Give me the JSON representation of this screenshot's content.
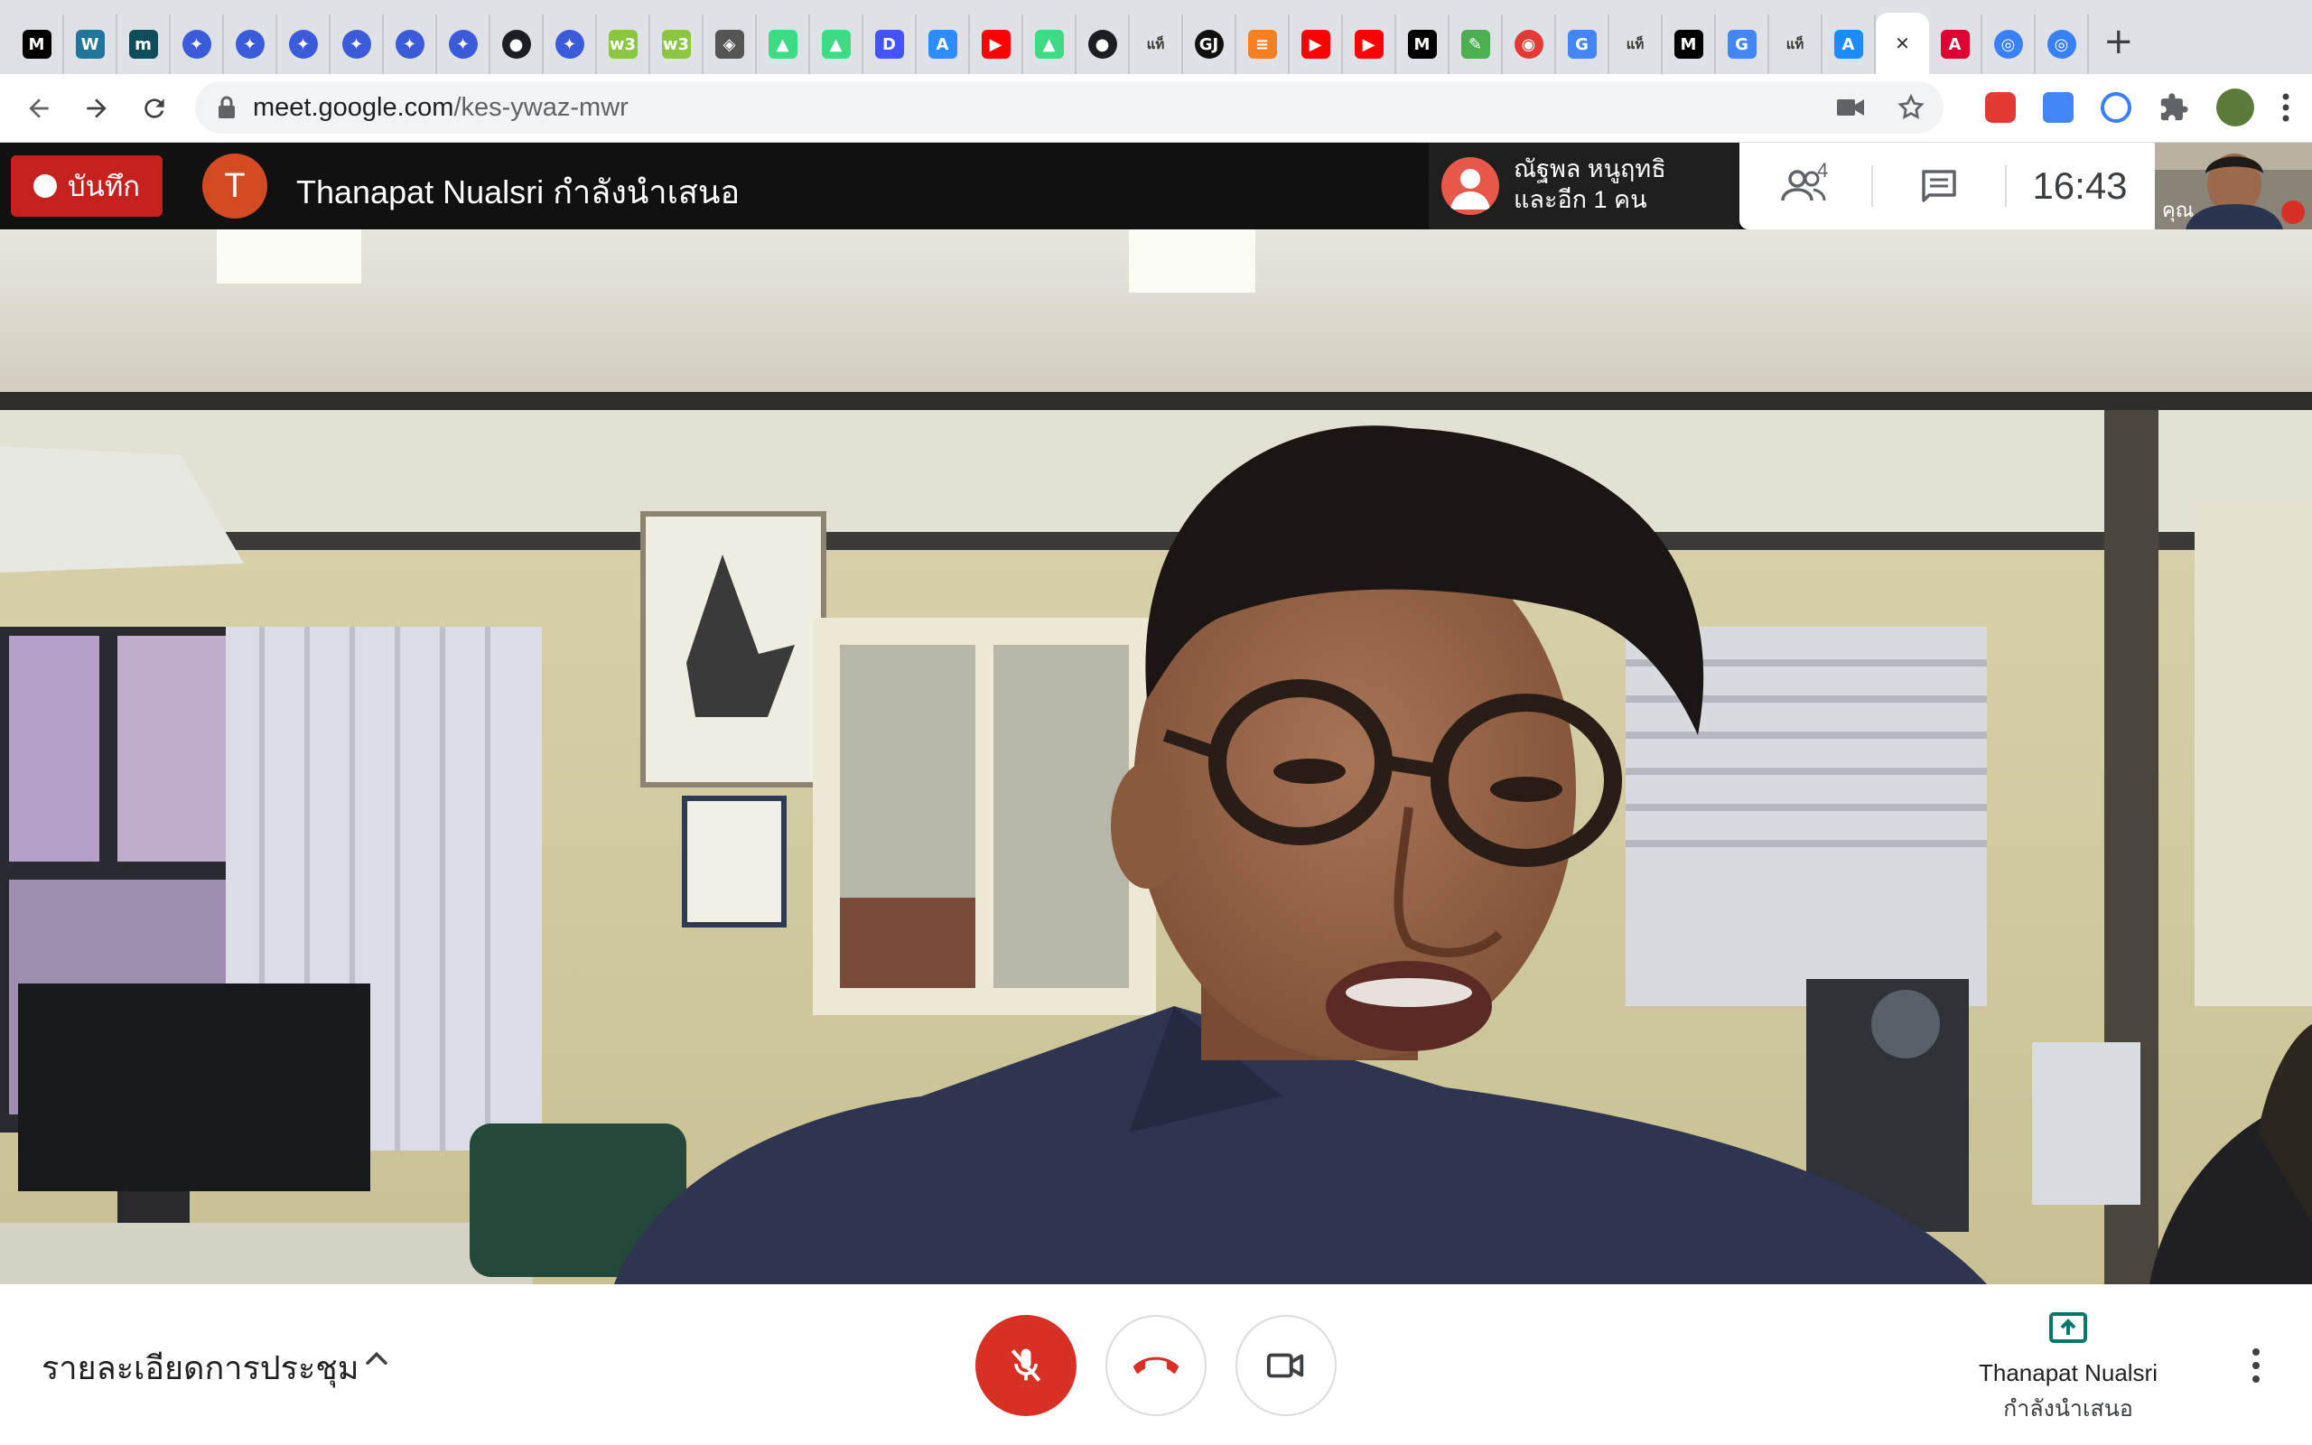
{
  "browser": {
    "tabs": [
      {
        "icon": "medium-icon",
        "glyph": "M",
        "color": "#000000"
      },
      {
        "icon": "wordpress-icon",
        "glyph": "W",
        "color": "#21759b"
      },
      {
        "icon": "m-brand-icon",
        "glyph": "m",
        "color": "#0f4c5c"
      },
      {
        "icon": "messenger-icon",
        "glyph": "✦",
        "color": "#3b5bdb"
      },
      {
        "icon": "messenger-icon",
        "glyph": "✦",
        "color": "#3b5bdb"
      },
      {
        "icon": "messenger-icon",
        "glyph": "✦",
        "color": "#3b5bdb"
      },
      {
        "icon": "messenger-icon",
        "glyph": "✦",
        "color": "#3b5bdb"
      },
      {
        "icon": "messenger-icon",
        "glyph": "✦",
        "color": "#3b5bdb"
      },
      {
        "icon": "messenger-icon",
        "glyph": "✦",
        "color": "#3b5bdb"
      },
      {
        "icon": "github-icon",
        "glyph": "●",
        "color": "#1b1f23"
      },
      {
        "icon": "messenger-icon",
        "glyph": "✦",
        "color": "#3b5bdb"
      },
      {
        "icon": "w3-icon",
        "glyph": "w3",
        "color": "#8ac640"
      },
      {
        "icon": "w3-icon",
        "glyph": "w3",
        "color": "#8ac640"
      },
      {
        "icon": "diamond-icon",
        "glyph": "◈",
        "color": "#555555"
      },
      {
        "icon": "android-icon",
        "glyph": "▲",
        "color": "#3ddc84"
      },
      {
        "icon": "android-icon",
        "glyph": "▲",
        "color": "#3ddc84"
      },
      {
        "icon": "dart-icon",
        "glyph": "D",
        "color": "#4353ff"
      },
      {
        "icon": "app-store-icon",
        "glyph": "A",
        "color": "#2d8cff"
      },
      {
        "icon": "youtube-icon",
        "glyph": "▶",
        "color": "#ff0000"
      },
      {
        "icon": "android-icon",
        "glyph": "▲",
        "color": "#3ddc84"
      },
      {
        "icon": "github-icon",
        "glyph": "●",
        "color": "#1b1f23"
      },
      {
        "icon": "thai-text-icon",
        "glyph": "แท็",
        "color": "#333333"
      },
      {
        "icon": "gj-icon",
        "glyph": "GJ",
        "color": "#111111"
      },
      {
        "icon": "stackoverflow-icon",
        "glyph": "≡",
        "color": "#f48024"
      },
      {
        "icon": "youtube-icon",
        "glyph": "▶",
        "color": "#ff0000"
      },
      {
        "icon": "youtube-icon",
        "glyph": "▶",
        "color": "#ff0000"
      },
      {
        "icon": "medium-icon",
        "glyph": "M",
        "color": "#000000"
      },
      {
        "icon": "tools-icon",
        "glyph": "✎",
        "color": "#4caf50"
      },
      {
        "icon": "record-icon",
        "glyph": "◉",
        "color": "#e53935"
      },
      {
        "icon": "translate-icon",
        "glyph": "G",
        "color": "#4285f4"
      },
      {
        "icon": "thai-text-icon",
        "glyph": "แท็",
        "color": "#333333"
      },
      {
        "icon": "medium-icon",
        "glyph": "M",
        "color": "#000000"
      },
      {
        "icon": "google-icon",
        "glyph": "G",
        "color": "#4285f4"
      },
      {
        "icon": "thai-text-icon",
        "glyph": "แท็",
        "color": "#333333"
      },
      {
        "icon": "app-store-icon",
        "glyph": "A",
        "color": "#1a8cff"
      },
      {
        "icon": "close-icon",
        "glyph": "✕",
        "color": "#3c4043",
        "active": true
      },
      {
        "icon": "angular-icon",
        "glyph": "A",
        "color": "#dd0031"
      },
      {
        "icon": "ionic-icon",
        "glyph": "◎",
        "color": "#3880ff"
      },
      {
        "icon": "ionic-icon",
        "glyph": "◎",
        "color": "#3880ff"
      }
    ],
    "new_tab": "+",
    "url_host": "meet.google.com",
    "url_path": "/kes-ywaz-mwr"
  },
  "meet": {
    "record_label": "บันทึก",
    "presenter_initial": "T",
    "presenter_title": "Thanapat Nualsri กำลังนำเสนอ",
    "speaker_line1": "ณัฐพล หนูฤทธิ",
    "speaker_line2": "และอีก 1 คน",
    "participants_count": "4",
    "clock": "16:43",
    "self_label": "คุณ",
    "details_label": "รายละเอียดการประชุม",
    "present_name": "Thanapat Nualsri",
    "present_sub": "กำลังนำเสนอ"
  },
  "colors": {
    "record_red": "#c5221f",
    "mic_off_red": "#d93025",
    "hangup_red": "#d93025",
    "present_green": "#00796b"
  }
}
